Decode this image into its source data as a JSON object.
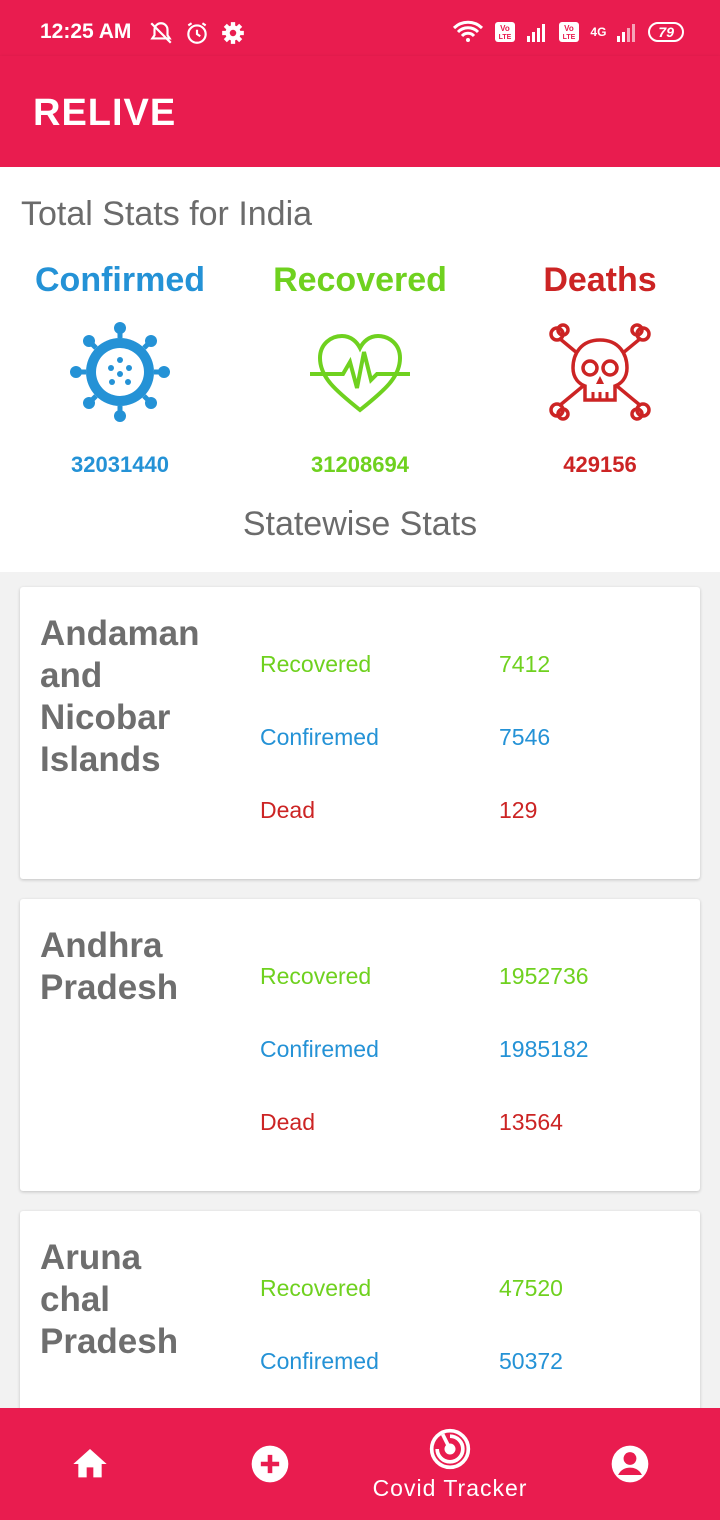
{
  "status_bar": {
    "time": "12:25 AM",
    "battery": "79",
    "network": "4G"
  },
  "app_bar": {
    "title": "RELIVE"
  },
  "totals": {
    "title": "Total Stats for India",
    "confirmed": {
      "label": "Confirmed",
      "value": "32031440",
      "color": "#2492d6",
      "icon": "virus-icon"
    },
    "recovered": {
      "label": "Recovered",
      "value": "31208694",
      "color": "#6fd11f",
      "icon": "heartbeat-icon"
    },
    "deaths": {
      "label": "Deaths",
      "value": "429156",
      "color": "#cc2424",
      "icon": "skull-crossbones-icon"
    }
  },
  "statewise": {
    "title": "Statewise Stats",
    "row_labels": {
      "recovered": "Recovered",
      "confirmed": "Confiremed",
      "dead": "Dead"
    },
    "states": [
      {
        "name": "Andaman and Nicobar Islands",
        "recovered": "7412",
        "confirmed": "7546",
        "dead": "129"
      },
      {
        "name": "Andhra Pradesh",
        "recovered": "1952736",
        "confirmed": "1985182",
        "dead": "13564"
      },
      {
        "name": "Aruna chal Pradesh",
        "recovered": "47520",
        "confirmed": "50372",
        "dead": ""
      }
    ]
  },
  "bottom_nav": {
    "items": [
      {
        "icon": "home-icon",
        "label": ""
      },
      {
        "icon": "add-circle-icon",
        "label": ""
      },
      {
        "icon": "radar-icon",
        "label": "Covid Tracker"
      },
      {
        "icon": "account-icon",
        "label": ""
      }
    ]
  }
}
